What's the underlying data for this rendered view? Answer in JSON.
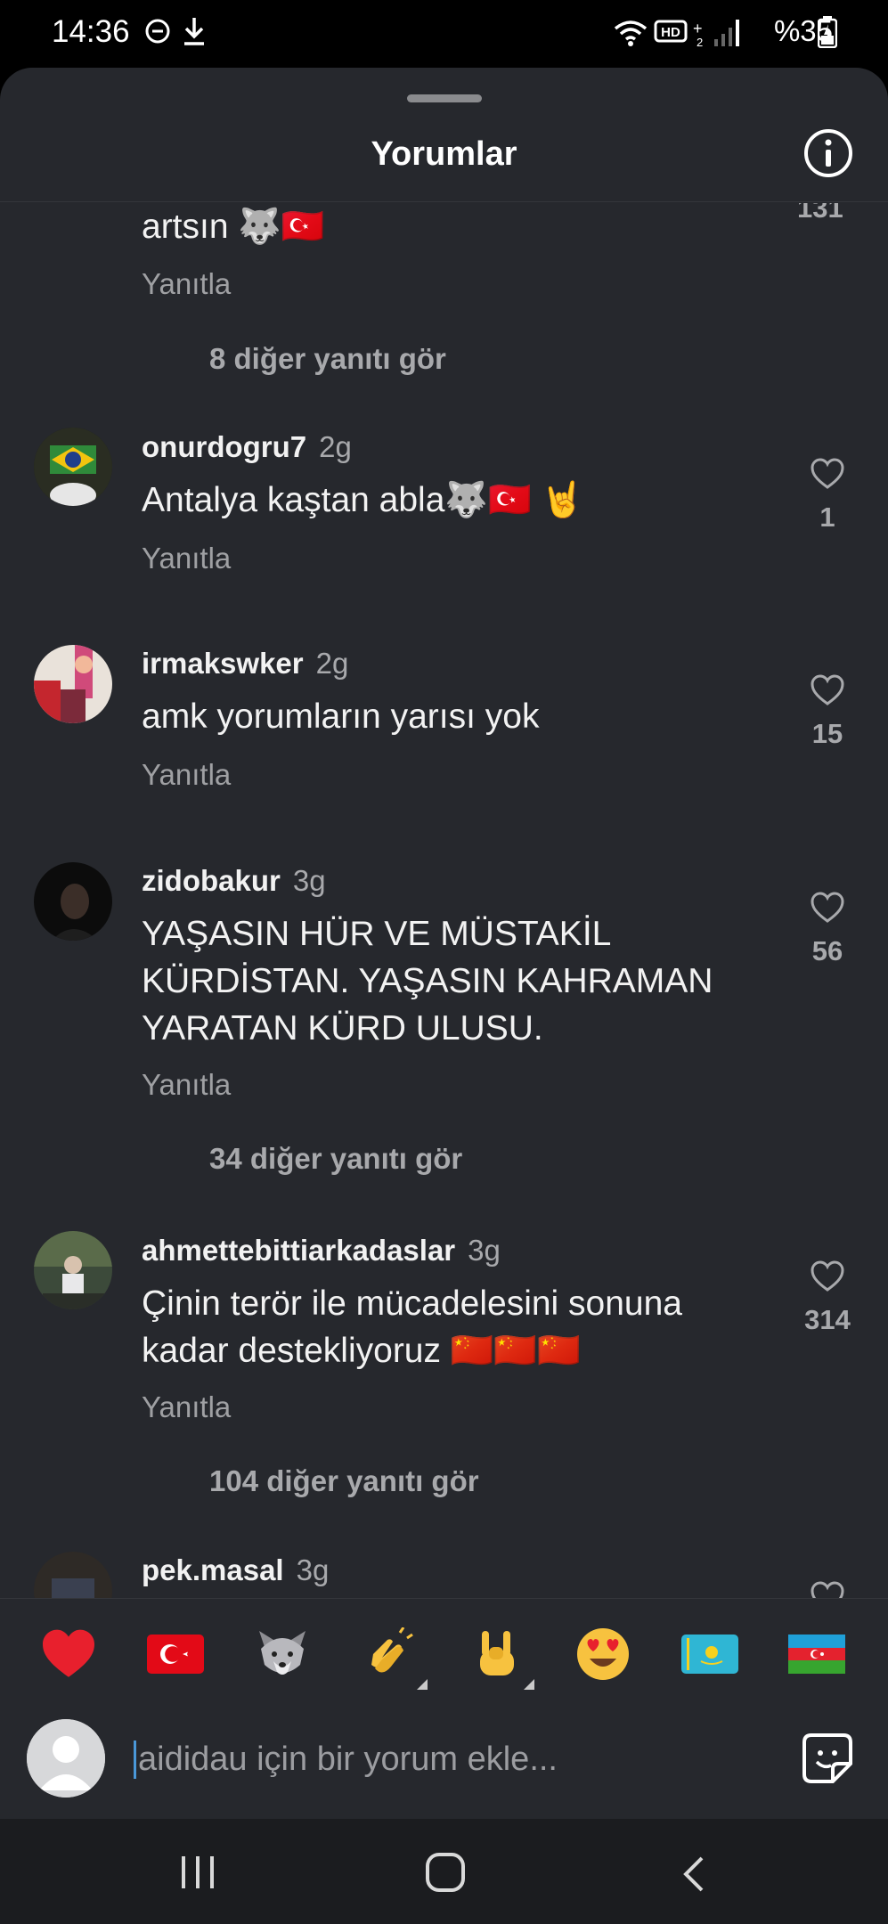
{
  "status_bar": {
    "time": "14:36",
    "battery": "%35"
  },
  "header": {
    "title": "Yorumlar"
  },
  "top_partial": {
    "text": "artsın 🐺🇹🇷",
    "reply": "Yanıtla",
    "more": "8 diğer yanıtı gör"
  },
  "comments": [
    {
      "user": "onurdogru7",
      "age": "2g",
      "text": "Antalya kaştan abla🐺🇹🇷 🤘",
      "reply": "Yanıtla",
      "likes": "1",
      "more": ""
    },
    {
      "user": "irmakswker",
      "age": "2g",
      "text": "amk yorumların yarısı yok",
      "reply": "Yanıtla",
      "likes": "15",
      "more": ""
    },
    {
      "user": "zidobakur",
      "age": "3g",
      "text": "YAŞASIN HÜR VE MÜSTAKİL\nKÜRDİSTAN. YAŞASIN KAHRAMAN\nYARATAN KÜRD ULUSU.",
      "reply": "Yanıtla",
      "likes": "56",
      "more": "34 diğer yanıtı gör"
    },
    {
      "user": "ahmettebittiarkadaslar",
      "age": "3g",
      "text": "Çinin terör ile mücadelesini sonuna\nkadar destekliyoruz 🇨🇳🇨🇳🇨🇳",
      "reply": "Yanıtla",
      "likes": "314",
      "more": "104 diğer yanıtı gör"
    },
    {
      "user": "pek.masal",
      "age": "3g"
    }
  ],
  "emoji_bar": [
    "❤️",
    "🇹🇷",
    "🐺",
    "👏",
    "🤘",
    "😍",
    "🇰🇿",
    "🇦🇿"
  ],
  "input": {
    "placeholder": "aididau için bir yorum ekle..."
  },
  "colors": {
    "sheet_bg": "#26282d",
    "status_bg": "#000000",
    "muted": "#a8a9ac",
    "heart_red": "#e8202d",
    "cursor": "#4a98d8"
  }
}
